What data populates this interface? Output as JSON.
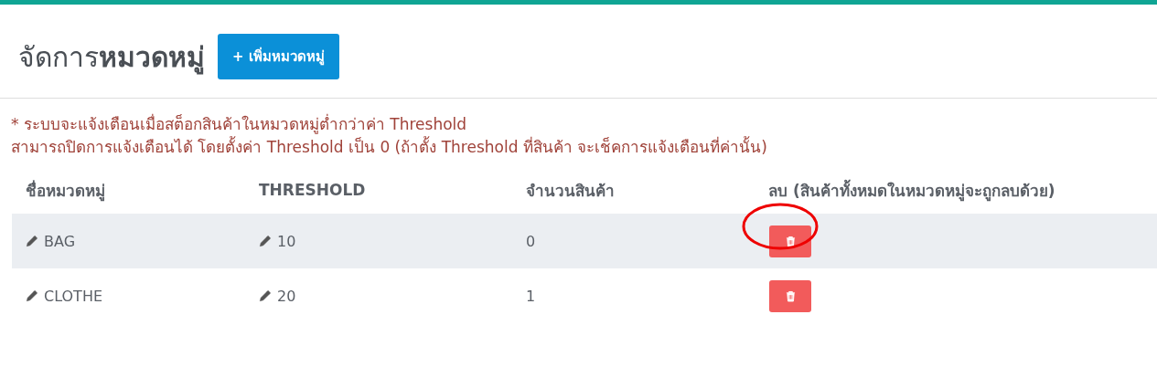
{
  "header": {
    "title": "จัดการ**หมวดหมู่**",
    "add_button": "+ เพิ่มหมวดหมู่"
  },
  "notes": [
    "* ระบบจะแจ้งเตือนเมื่อสต็อกสินค้าในหมวดหมู่ต่ำกว่าค่า Threshold",
    "สามารถปิดการแจ้งเตือนได้ โดยตั้งค่า Threshold เป็น 0 (ถ้าตั้ง Threshold ที่สินค้า จะเช็คการแจ้งเตือนที่ค่านั้น)"
  ],
  "table": {
    "columns": [
      "ชื่อหมวดหมู่",
      "THRESHOLD",
      "จำนวนสินค้า",
      "ลบ (สินค้าทั้งหมดในหมวดหมู่จะถูกลบด้วย)"
    ],
    "rows": [
      {
        "name": "BAG",
        "threshold": "10",
        "count": "0",
        "highlighted": true,
        "circled": true
      },
      {
        "name": "CLOTHE",
        "threshold": "20",
        "count": "1",
        "highlighted": false,
        "circled": false
      }
    ]
  }
}
